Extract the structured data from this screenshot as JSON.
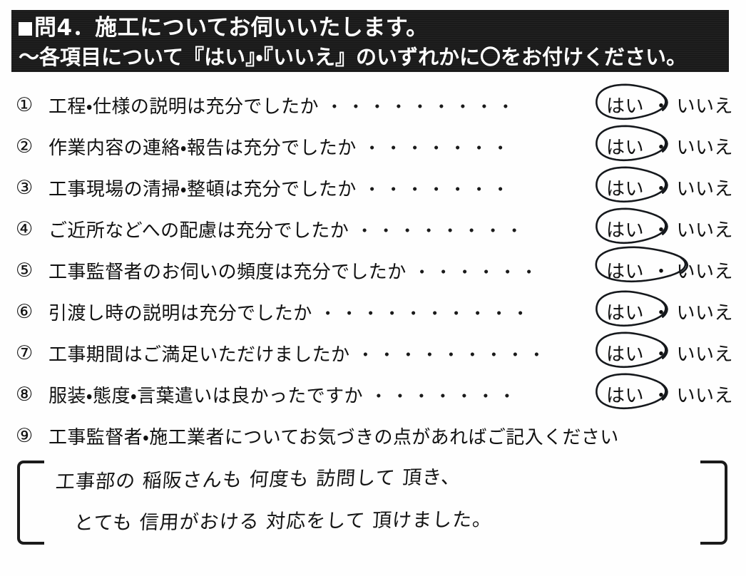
{
  "header": {
    "bullet_icon": "filled-square-bullet",
    "line1": "問4．施工についてお伺いいたします。",
    "line2": "～各項目について『はい』・『いいえ』のいずれかに〇をお付けください。"
  },
  "answer_labels": {
    "yes": "はい",
    "no": "いいえ",
    "separator": "・"
  },
  "questions": [
    {
      "number": "①",
      "text": "工程・仕様の説明は充分でしたか",
      "leader": "・・・・・・・・・",
      "selected": "はい",
      "circle_style": "normal"
    },
    {
      "number": "②",
      "text": "作業内容の連絡・報告は充分でしたか",
      "leader": "・・・・・・・",
      "selected": "はい",
      "circle_style": "normal"
    },
    {
      "number": "③",
      "text": "工事現場の清掃・整頓は充分でしたか",
      "leader": "・・・・・・・",
      "selected": "はい",
      "circle_style": "normal"
    },
    {
      "number": "④",
      "text": "ご近所などへの配慮は充分でしたか",
      "leader": "・・・・・・・・",
      "selected": "はい",
      "circle_style": "normal"
    },
    {
      "number": "⑤",
      "text": "工事監督者のお伺いの頻度は充分でしたか",
      "leader": "・・・・・・",
      "selected": "はい",
      "circle_style": "wide"
    },
    {
      "number": "⑥",
      "text": "引渡し時の説明は充分でしたか",
      "leader": "・・・・・・・・・・",
      "selected": "はい",
      "circle_style": "normal"
    },
    {
      "number": "⑦",
      "text": "工事期間はご満足いただけましたか",
      "leader": "・・・・・・・・・",
      "selected": "はい",
      "circle_style": "normal"
    },
    {
      "number": "⑧",
      "text": "服装・態度・言葉遣いは良かったですか",
      "leader": "・・・・・・・",
      "selected": "はい",
      "circle_style": "normal"
    }
  ],
  "free_comment": {
    "number": "⑨",
    "prompt": "工事監督者・施工業者についてお気づきの点があればご記入ください",
    "handwritten_line1": "工事部の 稲阪さんも 何度も 訪問して 頂き、",
    "handwritten_line2": "とても 信用がおける 対応をして 頂けました。",
    "bracket_left": "[",
    "bracket_right": "]"
  },
  "colors": {
    "header_background": "#1a1a1a",
    "header_text": "#ffffff",
    "page_background": "#ffffff",
    "print_text": "#111111",
    "pen_ink": "#15181c"
  }
}
